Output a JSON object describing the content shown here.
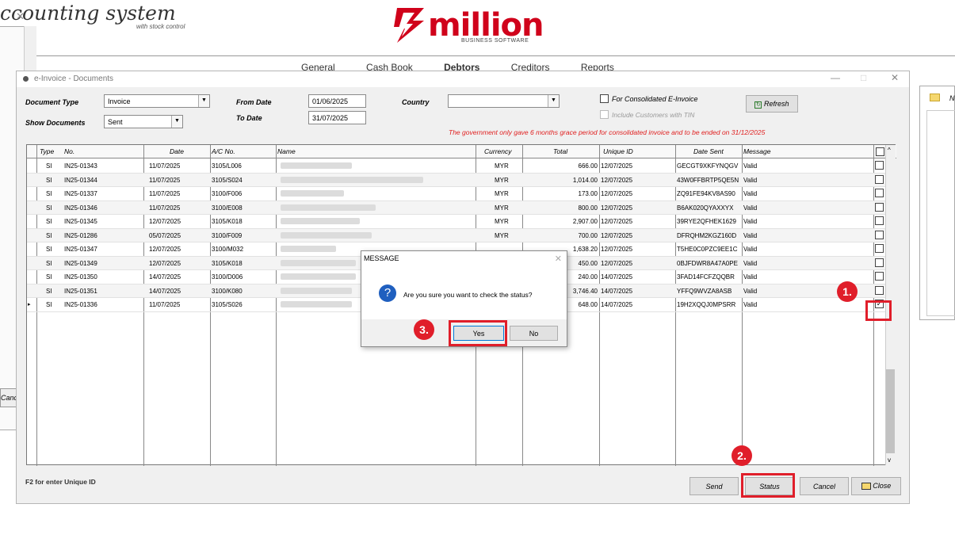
{
  "app": {
    "title": "ccounting system",
    "subtitle": "with stock control",
    "logo_text": "million",
    "logo_sub": "BUSINESS SOFTWARE",
    "nav": [
      "General",
      "Cash Book",
      "Debtors",
      "Creditors",
      "Reports"
    ],
    "left_cancel": "Cance",
    "right_panel_label": "N"
  },
  "window": {
    "title": "e-Invoice - Documents",
    "controls": [
      "—",
      "□",
      "✕"
    ]
  },
  "filters": {
    "document_type_label": "Document Type",
    "document_type_value": "Invoice",
    "show_documents_label": "Show Documents",
    "show_documents_value": "Sent",
    "from_date_label": "From Date",
    "from_date_value": "01/06/2025",
    "to_date_label": "To Date",
    "to_date_value": "31/07/2025",
    "country_label": "Country",
    "country_value": "",
    "consolidated_label": "For Consolidated E-Invoice",
    "include_tin_label": "Include Customers with TIN",
    "refresh_label": "Refresh"
  },
  "warning": "The government only gave 6 months grace period for consolidated invoice and to be ended on 31/12/2025",
  "table": {
    "headers": [
      "Type",
      "No.",
      "Date",
      "A/C No.",
      "Name",
      "Currency",
      "Total",
      "Unique ID",
      "Date Sent",
      "Message"
    ],
    "rows": [
      {
        "type": "SI",
        "no": "IN25-01343",
        "date": "11/07/2025",
        "ac": "3105/L006",
        "currency": "MYR",
        "total": "666.00",
        "unique": "12/07/2025",
        "sent": "GECGT9XKFYNQGV",
        "message": "Valid",
        "checked": false
      },
      {
        "type": "SI",
        "no": "IN25-01344",
        "date": "11/07/2025",
        "ac": "3105/S024",
        "currency": "MYR",
        "total": "1,014.00",
        "unique": "12/07/2025",
        "sent": "43W0FFBRTP5QE5N",
        "message": "Valid",
        "checked": false
      },
      {
        "type": "SI",
        "no": "IN25-01337",
        "date": "11/07/2025",
        "ac": "3100/F006",
        "currency": "MYR",
        "total": "173.00",
        "unique": "12/07/2025",
        "sent": "ZQ91FE94KV8AS90",
        "message": "Valid",
        "checked": false
      },
      {
        "type": "SI",
        "no": "IN25-01346",
        "date": "11/07/2025",
        "ac": "3100/E008",
        "currency": "MYR",
        "total": "800.00",
        "unique": "12/07/2025",
        "sent": "B6AK020QYAXXYX",
        "message": "Valid",
        "checked": false
      },
      {
        "type": "SI",
        "no": "IN25-01345",
        "date": "12/07/2025",
        "ac": "3105/K018",
        "currency": "MYR",
        "total": "2,907.00",
        "unique": "12/07/2025",
        "sent": "39RYE2QFHEK1629",
        "message": "Valid",
        "checked": false
      },
      {
        "type": "SI",
        "no": "IN25-01286",
        "date": "05/07/2025",
        "ac": "3100/F009",
        "currency": "MYR",
        "total": "700.00",
        "unique": "12/07/2025",
        "sent": "DFRQHM2KGZ160D",
        "message": "Valid",
        "checked": false
      },
      {
        "type": "SI",
        "no": "IN25-01347",
        "date": "12/07/2025",
        "ac": "3100/M032",
        "currency": "",
        "total": "1,638.20",
        "unique": "12/07/2025",
        "sent": "T5HE0C0PZC9EE1C",
        "message": "Valid",
        "checked": false
      },
      {
        "type": "SI",
        "no": "IN25-01349",
        "date": "12/07/2025",
        "ac": "3105/K018",
        "currency": "",
        "total": "450.00",
        "unique": "12/07/2025",
        "sent": "0BJFDWR8A47A0PE",
        "message": "Valid",
        "checked": false
      },
      {
        "type": "SI",
        "no": "IN25-01350",
        "date": "14/07/2025",
        "ac": "3100/D006",
        "currency": "",
        "total": "240.00",
        "unique": "14/07/2025",
        "sent": "3FAD14FCFZQQBR",
        "message": "Valid",
        "checked": false
      },
      {
        "type": "SI",
        "no": "IN25-01351",
        "date": "14/07/2025",
        "ac": "3100/K080",
        "currency": "",
        "total": "3,746.40",
        "unique": "14/07/2025",
        "sent": "YFFQ9WVZA8ASB",
        "message": "Valid",
        "checked": false
      },
      {
        "type": "SI",
        "no": "IN25-01336",
        "date": "11/07/2025",
        "ac": "3105/S026",
        "currency": "",
        "total": "648.00",
        "unique": "14/07/2025",
        "sent": "19H2XQQJ0MPSRR",
        "message": "Valid",
        "checked": true
      }
    ]
  },
  "footer": {
    "hint": "F2 for enter Unique ID",
    "send": "Send",
    "status": "Status",
    "cancel": "Cancel",
    "close": "Close"
  },
  "dialog": {
    "title": "MESSAGE",
    "close": "✕",
    "question": "Are you sure you want to check the status?",
    "yes": "Yes",
    "no": "No"
  },
  "annotations": {
    "step1": "1.",
    "step2": "2.",
    "step3": "3.",
    "color": "#e01e2a"
  }
}
